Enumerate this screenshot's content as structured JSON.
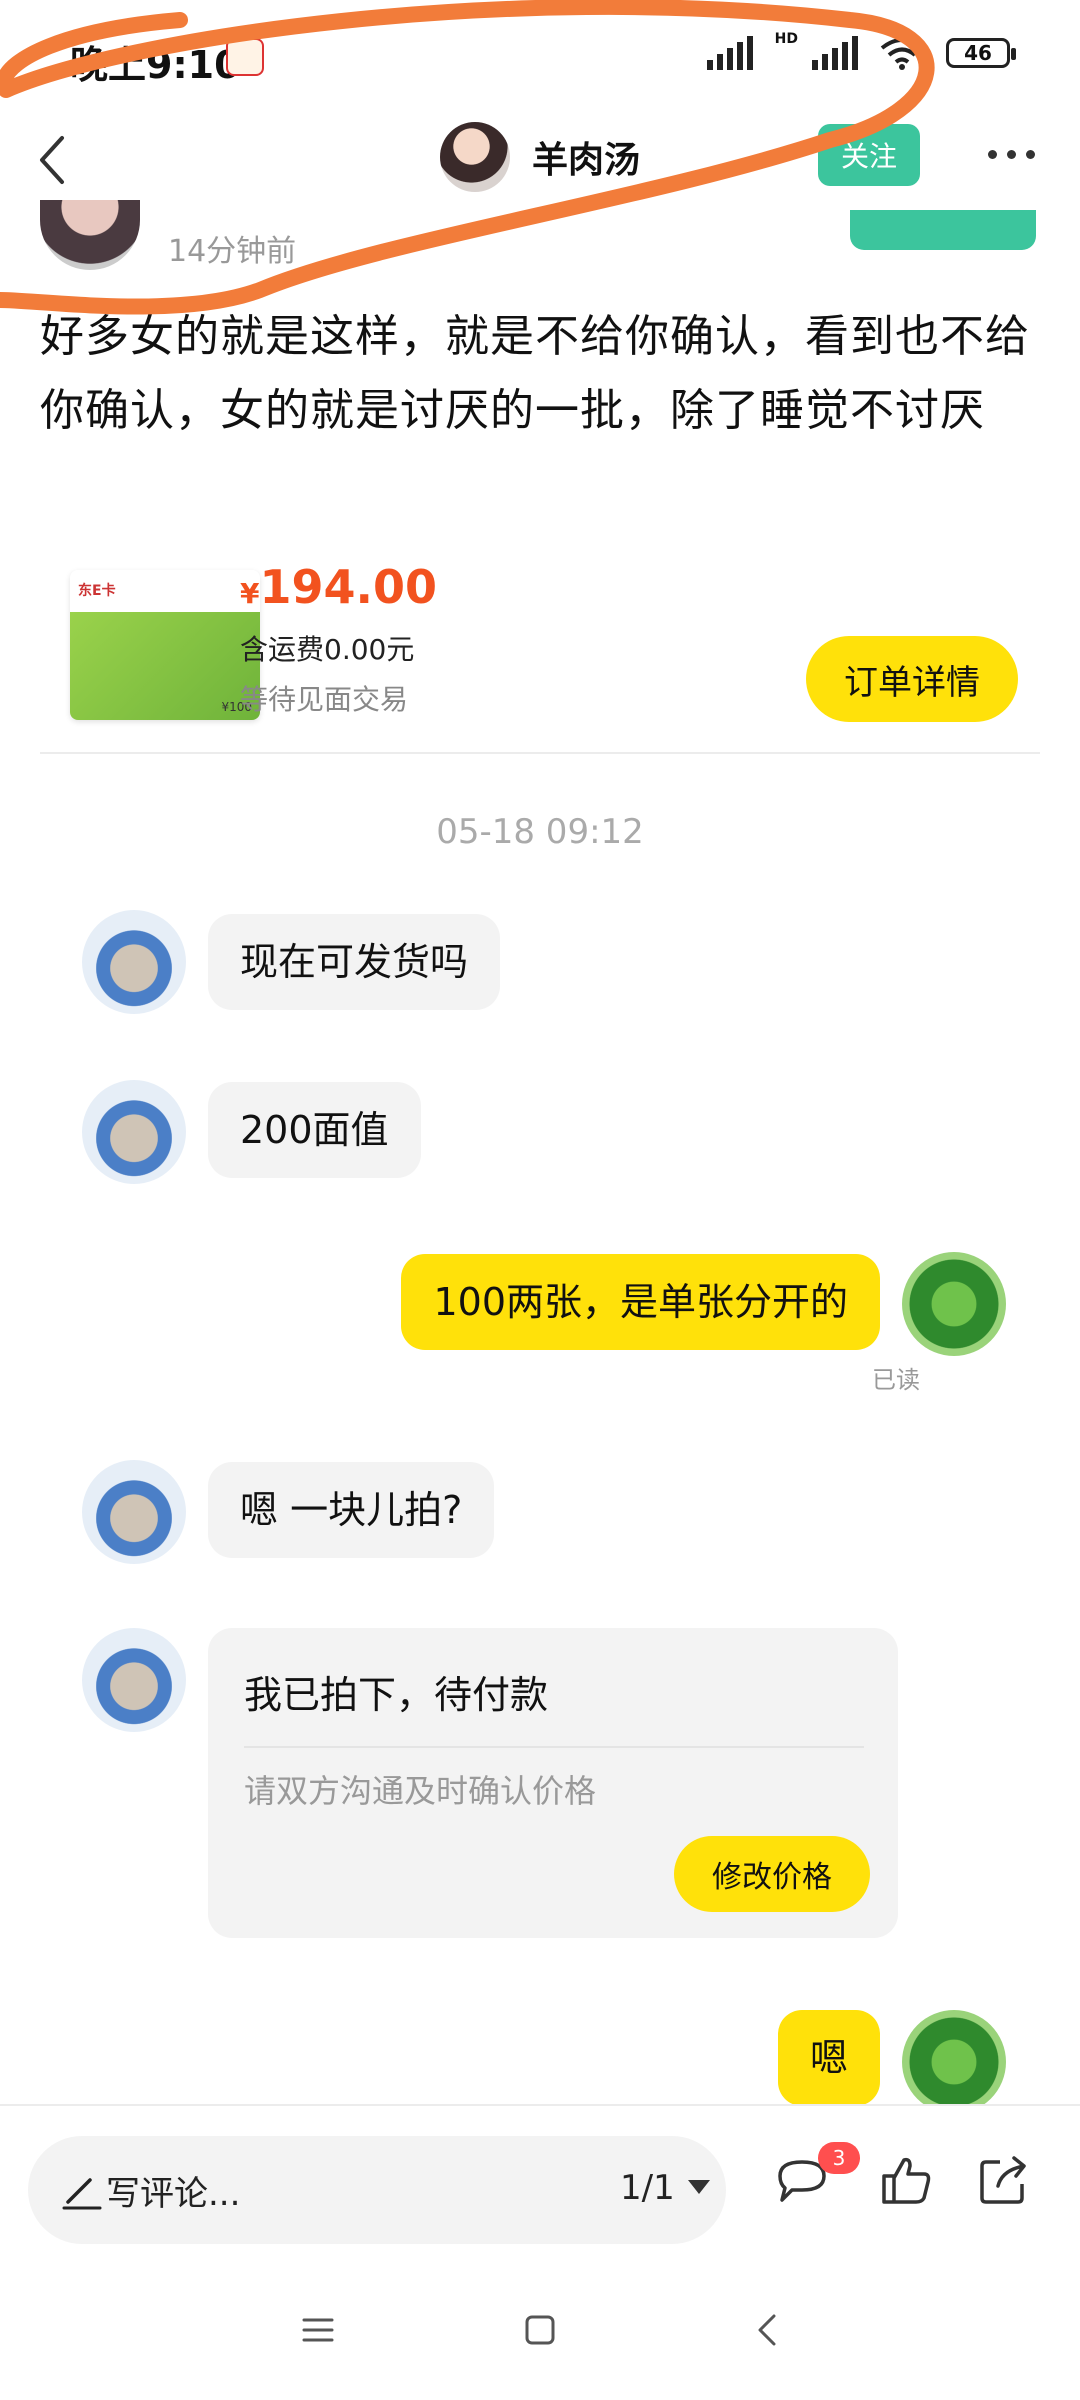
{
  "status_bar": {
    "time": "晚上9:10",
    "battery": "46",
    "network": "HD"
  },
  "header": {
    "title": "羊肉汤",
    "follow_label": "关注"
  },
  "post": {
    "time_ago": "14分钟前",
    "text": "好多女的就是这样，就是不给你确认，看到也不给你确认，女的就是讨厌的一批，除了睡觉不讨厌"
  },
  "order": {
    "card_brand": "东E卡",
    "card_value": "¥100",
    "currency": "¥",
    "price": "194.00",
    "shipping": "含运费0.00元",
    "status": "等待见面交易",
    "detail_button": "订单详情"
  },
  "chat": {
    "timestamp": "05-18 09:12",
    "messages": [
      {
        "side": "left",
        "text": "现在可发货吗"
      },
      {
        "side": "left",
        "text": "200面值"
      },
      {
        "side": "right",
        "text": "100两张，是单张分开的",
        "read": "已读"
      },
      {
        "side": "left",
        "text": "嗯 一块儿拍?"
      },
      {
        "side": "right",
        "text": "嗯"
      }
    ],
    "card_message": {
      "title": "我已拍下，待付款",
      "subtitle": "请双方沟通及时确认价格",
      "button": "修改价格"
    }
  },
  "bottom_bar": {
    "comment_placeholder": "写评论...",
    "page_indicator": "1/1",
    "comment_count": "3",
    "icons": [
      "pencil-icon",
      "comment-icon",
      "thumbs-up-icon",
      "share-icon"
    ]
  },
  "colors": {
    "accent_yellow": "#ffe10a",
    "follow_green": "#3cc59d",
    "price_orange": "#f2521f",
    "scribble": "#f27c3a"
  }
}
